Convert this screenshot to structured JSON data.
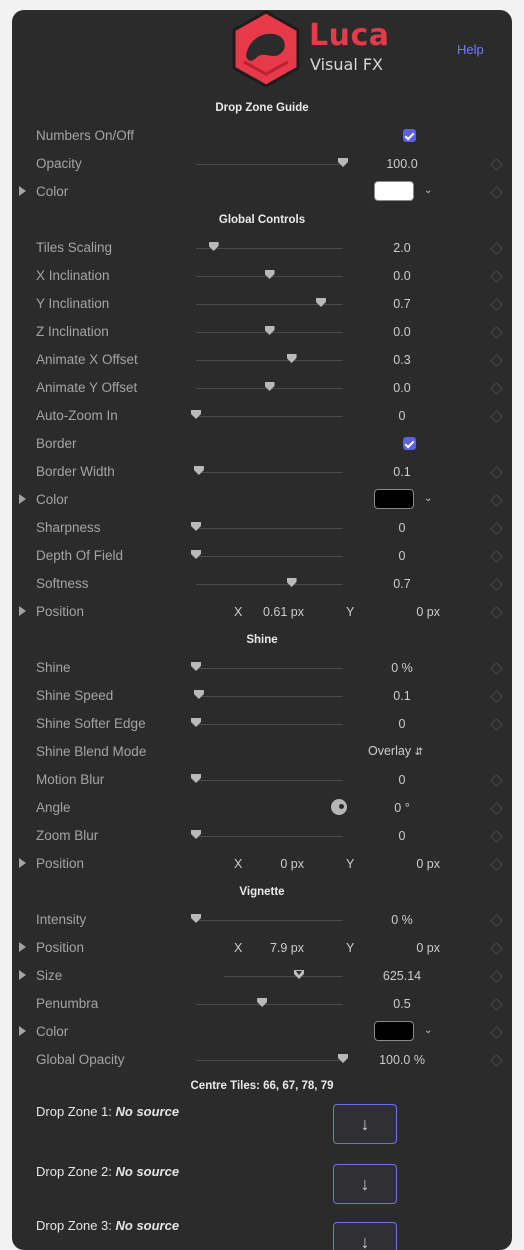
{
  "header": {
    "logo_text": "Luca",
    "logo_subtext": "Visual FX",
    "help_label": "Help",
    "colors": {
      "brand_red": "#e8394a",
      "accent": "#5b61e0"
    }
  },
  "sections": {
    "drop_zone_guide": "Drop Zone Guide",
    "global_controls": "Global Controls",
    "shine": "Shine",
    "vignette": "Vignette",
    "centre_tiles": "Centre Tiles: 66, 67, 78, 79"
  },
  "drop_zone_guide": {
    "numbers_label": "Numbers On/Off",
    "opacity_label": "Opacity",
    "opacity_value": "100.0",
    "opacity_level": 1.0,
    "color_label": "Color",
    "color_hex": "#ffffff"
  },
  "global": {
    "tiles_scaling": {
      "label": "Tiles Scaling",
      "value": "2.0",
      "level": 0.12
    },
    "x_inclination": {
      "label": "X Inclination",
      "value": "0.0",
      "level": 0.5
    },
    "y_inclination": {
      "label": "Y Inclination",
      "value": "0.7",
      "level": 0.85
    },
    "z_inclination": {
      "label": "Z Inclination",
      "value": "0.0",
      "level": 0.5
    },
    "animate_x": {
      "label": "Animate X Offset",
      "value": "0.3",
      "level": 0.65
    },
    "animate_y": {
      "label": "Animate Y Offset",
      "value": "0.0",
      "level": 0.5
    },
    "auto_zoom": {
      "label": "Auto-Zoom In",
      "value": "0",
      "level": 0.0
    },
    "border_label": "Border",
    "border_width": {
      "label": "Border Width",
      "value": "0.1",
      "level": 0.02
    },
    "color_label": "Color",
    "color_hex": "#000000",
    "sharpness": {
      "label": "Sharpness",
      "value": "0",
      "level": 0.0
    },
    "dof": {
      "label": "Depth Of Field",
      "value": "0",
      "level": 0.0
    },
    "softness": {
      "label": "Softness",
      "value": "0.7",
      "level": 0.65
    },
    "position": {
      "label": "Position",
      "x_label": "X",
      "x_value": "0.61 px",
      "y_label": "Y",
      "y_value": "0 px"
    }
  },
  "shine": {
    "shine": {
      "label": "Shine",
      "value": "0 %",
      "level": 0.0
    },
    "speed": {
      "label": "Shine Speed",
      "value": "0.1",
      "level": 0.02
    },
    "softer_edge": {
      "label": "Shine Softer Edge",
      "value": "0",
      "level": 0.0
    },
    "blend_mode": {
      "label": "Shine Blend Mode",
      "value": "Overlay"
    },
    "motion_blur": {
      "label": "Motion Blur",
      "value": "0",
      "level": 0.0
    },
    "angle": {
      "label": "Angle",
      "value": "0 °"
    },
    "zoom_blur": {
      "label": "Zoom Blur",
      "value": "0",
      "level": 0.0
    },
    "position": {
      "label": "Position",
      "x_label": "X",
      "x_value": "0 px",
      "y_label": "Y",
      "y_value": "0 px"
    }
  },
  "vignette": {
    "intensity": {
      "label": "Intensity",
      "value": "0 %",
      "level": 0.0
    },
    "position": {
      "label": "Position",
      "x_label": "X",
      "x_value": "7.9 px",
      "y_label": "Y",
      "y_value": "0 px"
    },
    "size": {
      "label": "Size",
      "value": "625.14",
      "level": 0.63
    },
    "penumbra": {
      "label": "Penumbra",
      "value": "0.5",
      "level": 0.45
    },
    "color_label": "Color",
    "color_hex": "#000000",
    "global_opacity": {
      "label": "Global Opacity",
      "value": "100.0 %",
      "level": 1.0
    }
  },
  "drop_zones": [
    {
      "label": "Drop Zone 1:",
      "status": "No source"
    },
    {
      "label": "Drop Zone 2:",
      "status": "No source"
    },
    {
      "label": "Drop Zone 3:",
      "status": "No source"
    }
  ]
}
